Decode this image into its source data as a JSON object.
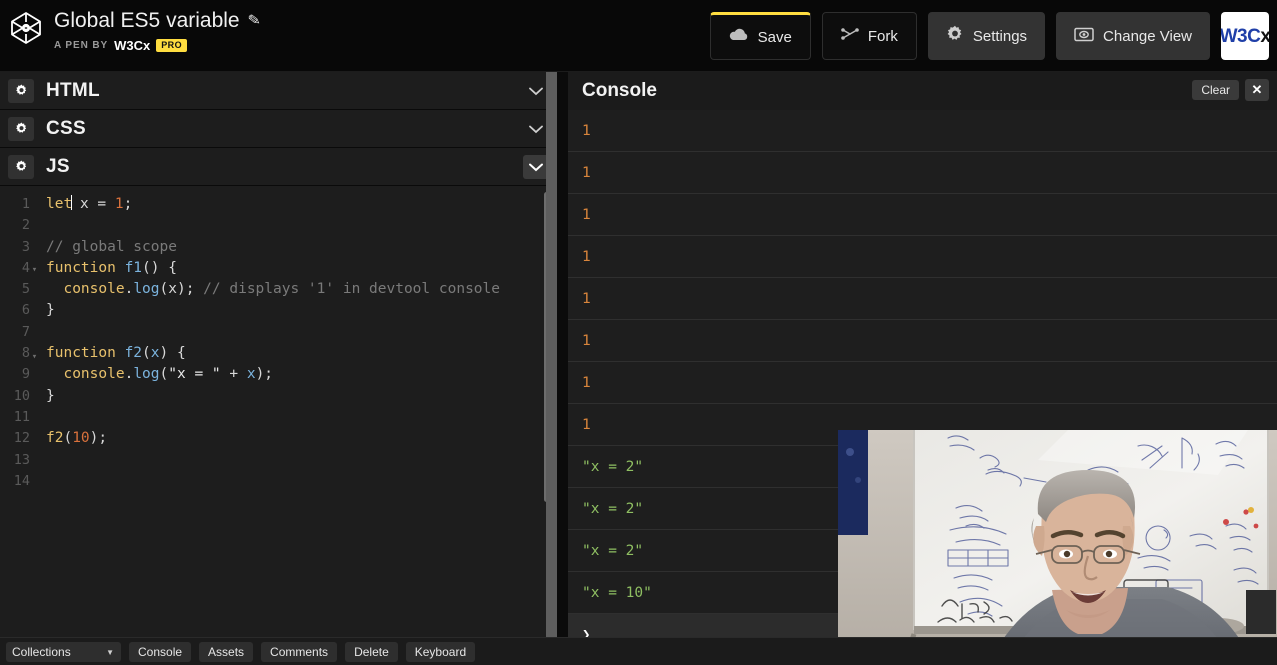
{
  "header": {
    "logo_icon": "codepen-hexagon-icon",
    "pen_title": "Global ES5 variable",
    "edit_icon": "pencil-icon",
    "byline_prefix": "A PEN BY",
    "author": "W3Cx",
    "pro_badge": "PRO",
    "buttons": [
      {
        "label": "Save",
        "icon": "cloud-icon"
      },
      {
        "label": "Fork",
        "icon": "fork-icon"
      },
      {
        "label": "Settings",
        "icon": "gear-icon"
      },
      {
        "label": "Change View",
        "icon": "view-icon"
      }
    ],
    "avatar": {
      "name": "w3cx-avatar",
      "part_blue": "W3C",
      "part_dark": "x"
    },
    "accent_color": "#ffdd40"
  },
  "editor": {
    "panels": [
      {
        "label": "HTML",
        "gear_icon": "gear-icon",
        "chevron_icon": "chevron-down-icon",
        "expanded": false
      },
      {
        "label": "CSS",
        "gear_icon": "gear-icon",
        "chevron_icon": "chevron-down-icon",
        "expanded": false
      },
      {
        "label": "JS",
        "gear_icon": "gear-icon",
        "chevron_icon": "chevron-down-icon",
        "expanded": true
      }
    ],
    "line_numbers": [
      "1",
      "2",
      "3",
      "4",
      "5",
      "6",
      "7",
      "8",
      "9",
      "10",
      "11",
      "12",
      "13",
      "14"
    ],
    "fold_lines": [
      4,
      8
    ],
    "code_lines": [
      "let x = 1;",
      "",
      "// global scope",
      "function f1() {",
      "  console.log(x); // displays '1' in devtool console",
      "}",
      "",
      "function f2(x) {",
      "  console.log(\"x = \" + x);",
      "}",
      "",
      "f2(10);",
      "",
      ""
    ],
    "syntax_colors": {
      "keyword": "#e8c16c",
      "function": "#7bb3dd",
      "number": "#d9713c",
      "comment": "#7a7a7a",
      "text": "#e6e6e6"
    }
  },
  "console": {
    "title": "Console",
    "clear_label": "Clear",
    "close_icon": "close-icon",
    "prompt_symbol": "❯",
    "rows": [
      {
        "value": "1",
        "kind": "num"
      },
      {
        "value": "1",
        "kind": "num"
      },
      {
        "value": "1",
        "kind": "num"
      },
      {
        "value": "1",
        "kind": "num"
      },
      {
        "value": "1",
        "kind": "num"
      },
      {
        "value": "1",
        "kind": "num"
      },
      {
        "value": "1",
        "kind": "num"
      },
      {
        "value": "1",
        "kind": "num"
      },
      {
        "value": "\"x = 2\"",
        "kind": "str"
      },
      {
        "value": "\"x = 2\"",
        "kind": "str"
      },
      {
        "value": "\"x = 2\"",
        "kind": "str"
      },
      {
        "value": "\"x = 10\"",
        "kind": "str"
      }
    ],
    "number_color": "#d9853c",
    "string_color": "#8fbf62"
  },
  "webcam": {
    "name": "webcam-video-overlay",
    "description": "presenter in front of whiteboard"
  },
  "bottom_bar": {
    "collections": {
      "label": "Collections",
      "caret_icon": "caret-down-icon"
    },
    "buttons": [
      {
        "label": "Console"
      },
      {
        "label": "Assets"
      },
      {
        "label": "Comments"
      },
      {
        "label": "Delete"
      },
      {
        "label": "Keyboard"
      }
    ]
  }
}
